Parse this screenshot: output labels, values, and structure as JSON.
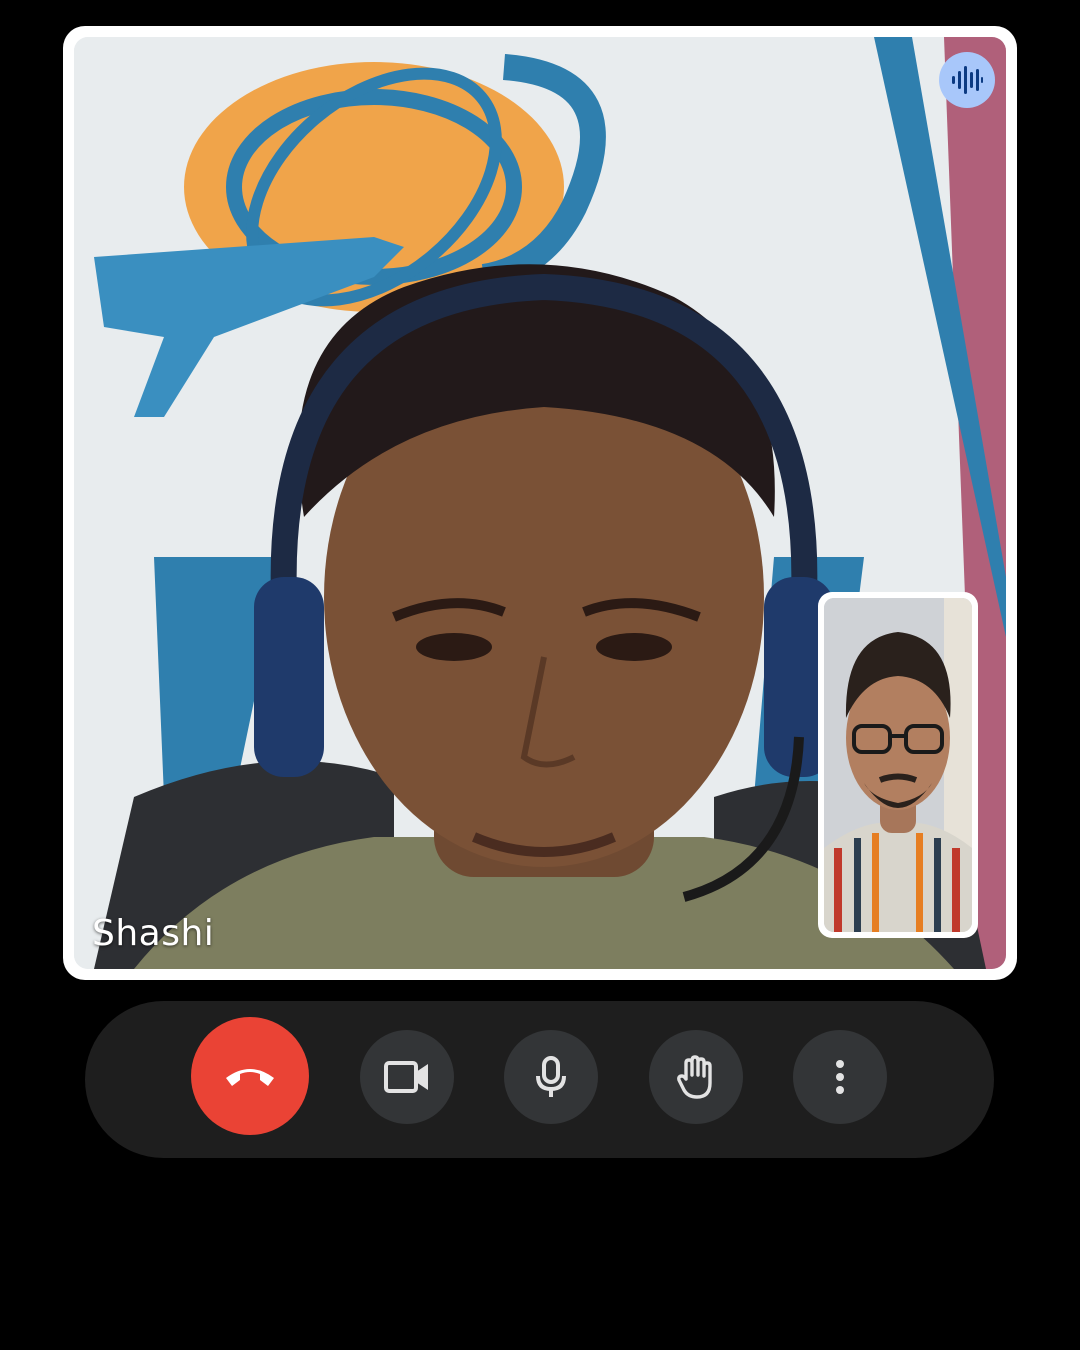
{
  "call": {
    "participant_name": "Shashi",
    "speaking_indicator_icon": "audio-waveform-icon"
  },
  "controls": {
    "end_call_icon": "call-end-icon",
    "camera_icon": "videocam-icon",
    "mic_icon": "mic-icon",
    "raise_hand_icon": "hand-icon",
    "more_icon": "more-vert-icon"
  },
  "colors": {
    "end_call": "#ea4335",
    "control_button": "#333537",
    "control_bar": "#1e1e1e",
    "speaking_badge": "#a8c7fa",
    "background": "#000000"
  }
}
